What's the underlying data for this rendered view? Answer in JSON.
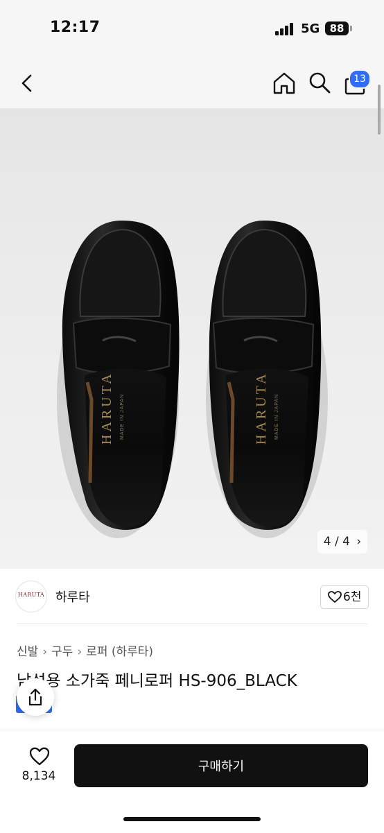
{
  "status_bar": {
    "time": "12:17",
    "network": "5G",
    "battery": "88"
  },
  "nav": {
    "icons": [
      "back-icon",
      "home-icon",
      "search-icon",
      "shopping-bag-icon"
    ],
    "cart_badge": "13"
  },
  "gallery": {
    "pager": "4 / 4",
    "logo_text": "HARUTA",
    "sub_text": "MADE IN JAPAN"
  },
  "brand": {
    "logo_text": "HARUTA",
    "name": "하루타",
    "like_label": "6천"
  },
  "breadcrumb": [
    "신발",
    "구두",
    "로퍼 (하루타)"
  ],
  "product": {
    "title": "남성용 소가죽 페니로퍼 HS-906_BLACK"
  },
  "bottom_bar": {
    "wishlist_count": "8,134",
    "buy_label": "구매하기"
  },
  "colors": {
    "accent": "#2f6df6",
    "primary_button": "#111111",
    "brand_logo": "#8a1e2c"
  }
}
